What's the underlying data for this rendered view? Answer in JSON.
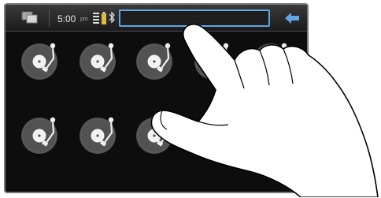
{
  "statusbar": {
    "time": "5:00",
    "time_suffix": "pm",
    "icons": [
      "task-switcher-icon",
      "signal-icon",
      "battery-icon",
      "bluetooth-icon",
      "back-arrow-icon"
    ],
    "accent_color": "#5fa6e3"
  },
  "search": {
    "value": "",
    "placeholder": ""
  },
  "grid": {
    "icon": "turntable-icon",
    "rows": 2,
    "items": [
      {
        "icon": "turntable-icon"
      },
      {
        "icon": "turntable-icon"
      },
      {
        "icon": "turntable-icon"
      },
      {
        "icon": "turntable-icon"
      },
      {
        "icon": "turntable-icon"
      },
      {
        "icon": "turntable-icon"
      },
      {
        "icon": "turntable-icon"
      },
      {
        "icon": "turntable-icon"
      },
      {
        "icon": "turntable-icon"
      },
      {
        "icon": "turntable-icon"
      }
    ]
  },
  "overlay": {
    "icon": "pointing-hand"
  }
}
